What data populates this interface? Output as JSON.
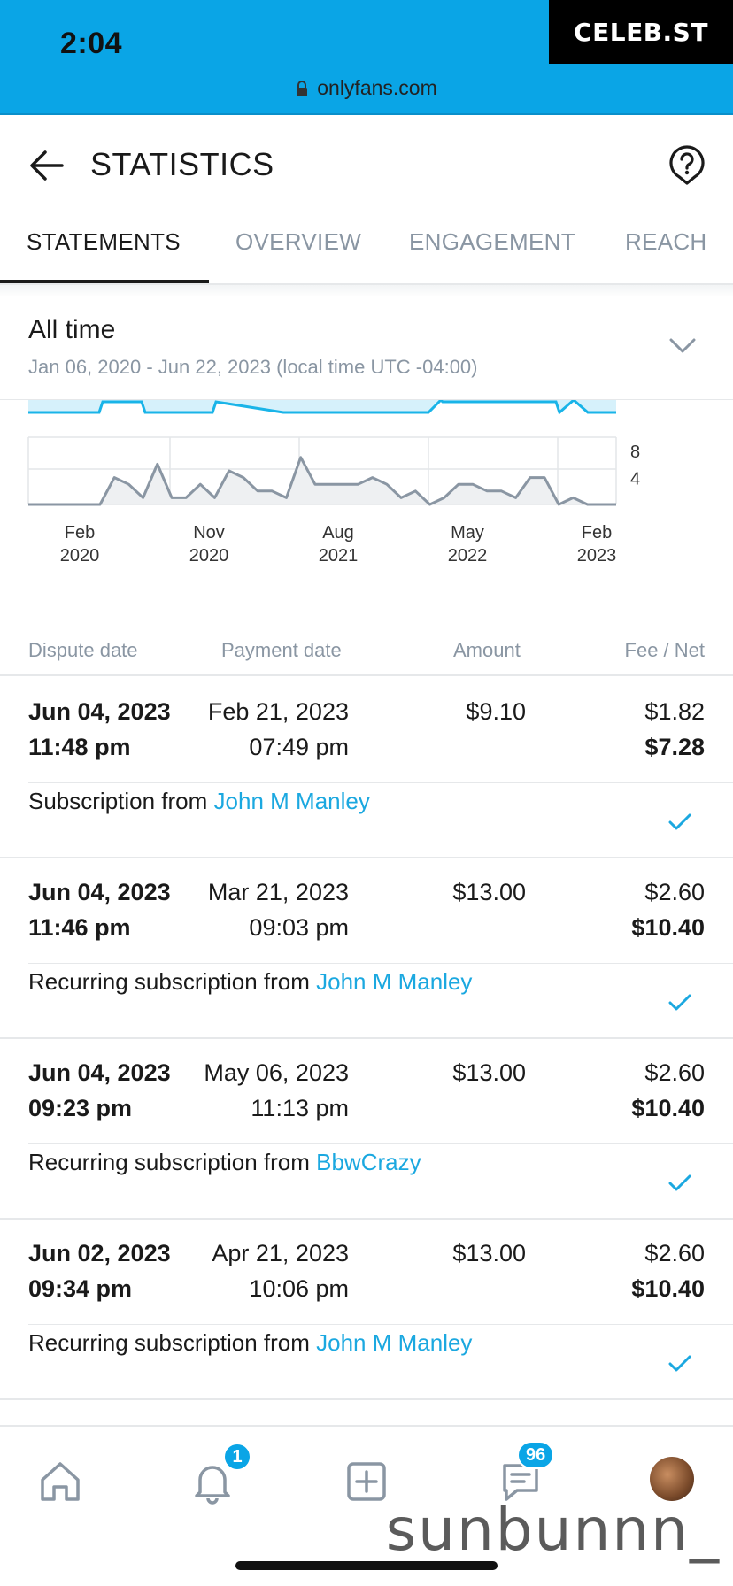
{
  "status_bar": {
    "time": "2:04",
    "brand": "CELEB.ST",
    "url": "onlyfans.com"
  },
  "header": {
    "title": "STATISTICS"
  },
  "tabs": [
    {
      "label": "STATEMENTS",
      "active": true
    },
    {
      "label": "OVERVIEW",
      "active": false
    },
    {
      "label": "ENGAGEMENT",
      "active": false
    },
    {
      "label": "REACH",
      "active": false
    }
  ],
  "period": {
    "title": "All time",
    "range": "Jan 06, 2020 - Jun 22, 2023 (local time UTC -04:00)"
  },
  "chart_data": {
    "type": "line",
    "x_tick_labels": [
      [
        "Feb",
        "2020"
      ],
      [
        "Nov",
        "2020"
      ],
      [
        "Aug",
        "2021"
      ],
      [
        "May",
        "2022"
      ],
      [
        "Feb",
        "2023"
      ]
    ],
    "y_tick_labels": [
      "8",
      "4"
    ],
    "ylim": [
      0,
      10
    ],
    "series": [
      {
        "values": [
          0,
          0,
          0,
          0,
          0,
          0,
          4,
          3,
          1,
          6,
          1,
          1,
          3,
          1,
          5,
          4,
          2,
          2,
          1,
          7,
          3,
          3,
          3,
          3,
          4,
          3,
          1,
          2,
          0,
          1,
          3,
          3,
          2,
          2,
          1,
          4,
          4,
          0,
          1,
          0,
          0,
          0
        ]
      }
    ],
    "colors": {
      "line": "#8a96a3",
      "area": "#eef0f2",
      "top_line": "#19b4e8",
      "top_area": "#d6f1fb"
    }
  },
  "table": {
    "columns": [
      "Dispute date",
      "Payment date",
      "Amount",
      "Fee / Net"
    ],
    "rows": [
      {
        "dispute_date": "Jun 04, 2023",
        "dispute_time": "11:48 pm",
        "payment_date": "Feb 21, 2023",
        "payment_time": "07:49 pm",
        "amount": "$9.10",
        "fee": "$1.82",
        "net": "$7.28",
        "desc_prefix": "Subscription from",
        "user": "John M Manley"
      },
      {
        "dispute_date": "Jun 04, 2023",
        "dispute_time": "11:46 pm",
        "payment_date": "Mar 21, 2023",
        "payment_time": "09:03 pm",
        "amount": "$13.00",
        "fee": "$2.60",
        "net": "$10.40",
        "desc_prefix": "Recurring subscription from",
        "user": "John M Manley"
      },
      {
        "dispute_date": "Jun 04, 2023",
        "dispute_time": "09:23 pm",
        "payment_date": "May 06, 2023",
        "payment_time": "11:13 pm",
        "amount": "$13.00",
        "fee": "$2.60",
        "net": "$10.40",
        "desc_prefix": "Recurring subscription from",
        "user": "BbwCrazy"
      },
      {
        "dispute_date": "Jun 02, 2023",
        "dispute_time": "09:34 pm",
        "payment_date": "Apr 21, 2023",
        "payment_time": "10:06 pm",
        "amount": "$13.00",
        "fee": "$2.60",
        "net": "$10.40",
        "desc_prefix": "Recurring subscription from",
        "user": "John M Manley"
      }
    ]
  },
  "bottom_nav": {
    "notifications_badge": "1",
    "messages_badge": "96",
    "icons": [
      "home-icon",
      "bell-icon",
      "add-post-icon",
      "messages-icon",
      "avatar"
    ]
  },
  "watermark": "sunbunnn_",
  "colors": {
    "accent": "#0aa5e6",
    "link": "#1ba8e0",
    "muted": "#8a96a3"
  }
}
